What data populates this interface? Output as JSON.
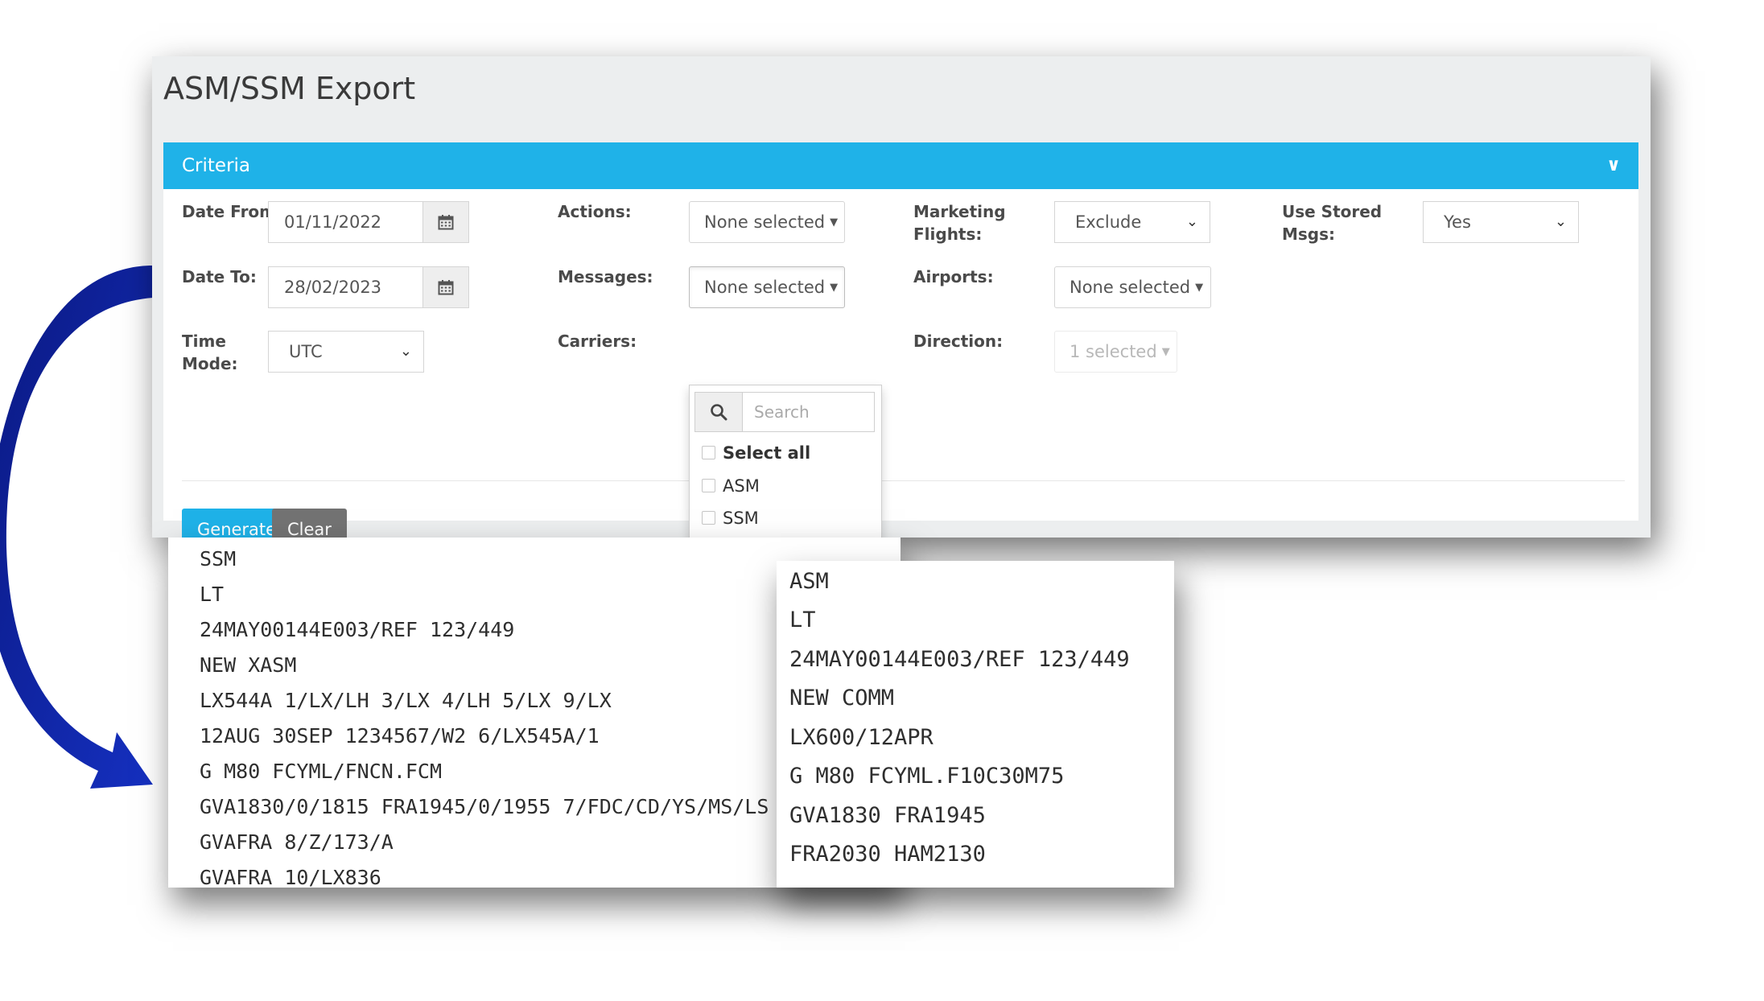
{
  "page_title": "ASM/SSM Export",
  "criteria": {
    "title": "Criteria",
    "date_from": {
      "label": "Date From:",
      "value": "01/11/2022"
    },
    "date_to": {
      "label": "Date To:",
      "value": "28/02/2023"
    },
    "time_mode": {
      "label_line1": "Time",
      "label_line2": "Mode:",
      "value": "UTC"
    },
    "actions": {
      "label": "Actions:",
      "value": "None selected"
    },
    "messages": {
      "label": "Messages:",
      "value": "None selected",
      "menu": {
        "search_placeholder": "Search",
        "select_all": "Select all",
        "options": [
          "ASM",
          "SSM"
        ]
      }
    },
    "carriers": {
      "label": "Carriers:"
    },
    "marketing_flights": {
      "label_line1": "Marketing",
      "label_line2": "Flights:",
      "value": "Exclude"
    },
    "airports": {
      "label": "Airports:",
      "value": "None selected"
    },
    "direction": {
      "label": "Direction:",
      "value": "1 selected"
    },
    "use_stored_msgs": {
      "label_line1": "Use Stored",
      "label_line2": "Msgs:",
      "value": "Yes"
    },
    "generate_label": "Generate",
    "clear_label": "Clear"
  },
  "samples": {
    "ssm_lines": [
      "SSM",
      "LT",
      "24MAY00144E003/REF 123/449",
      "NEW XASM",
      "LX544A 1/LX/LH 3/LX 4/LH 5/LX 9/LX",
      "12AUG 30SEP 1234567/W2 6/LX545A/1",
      "G M80 FCYML/FNCN.FCM",
      "GVA1830/0/1815 FRA1945/0/1955 7/FDC/CD/YS/MS/LS",
      "GVAFRA 8/Z/173/A",
      "GVAFRA 10/LX836"
    ],
    "asm_lines": [
      "ASM",
      "LT",
      "24MAY00144E003/REF 123/449",
      "NEW COMM",
      "LX600/12APR",
      "G M80 FCYML.F10C30M75",
      "GVA1830 FRA1945",
      "FRA2030 HAM2130"
    ]
  },
  "colors": {
    "accent": "#1fb2e8",
    "arrow": "#0d1a9e",
    "clear_button": "#737373"
  }
}
